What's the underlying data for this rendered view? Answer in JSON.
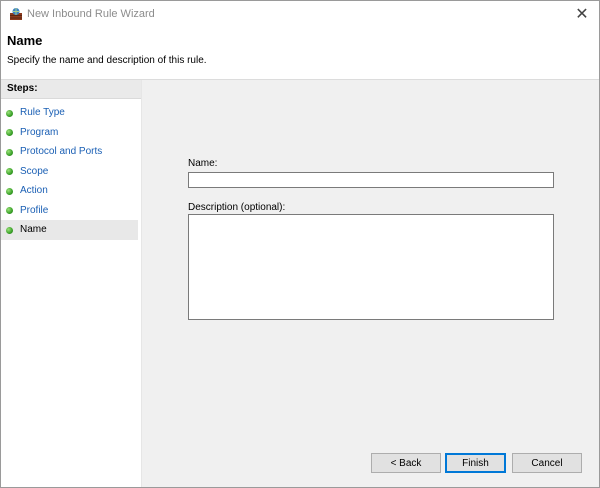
{
  "window": {
    "title": "New Inbound Rule Wizard",
    "close_symbol": "✕"
  },
  "header": {
    "title": "Name",
    "description": "Specify the name and description of this rule."
  },
  "steps": {
    "heading": "Steps:",
    "items": [
      {
        "label": "Rule Type"
      },
      {
        "label": "Program"
      },
      {
        "label": "Protocol and Ports"
      },
      {
        "label": "Scope"
      },
      {
        "label": "Action"
      },
      {
        "label": "Profile"
      },
      {
        "label": "Name"
      }
    ],
    "active_index": 6
  },
  "form": {
    "name_label": "Name:",
    "name_value": "",
    "description_label": "Description (optional):",
    "description_value": ""
  },
  "buttons": {
    "back": "< Back",
    "finish": "Finish",
    "cancel": "Cancel"
  },
  "colors": {
    "link": "#1a5fb4",
    "accent": "#0078d7",
    "step_dot": "#3aa028"
  }
}
